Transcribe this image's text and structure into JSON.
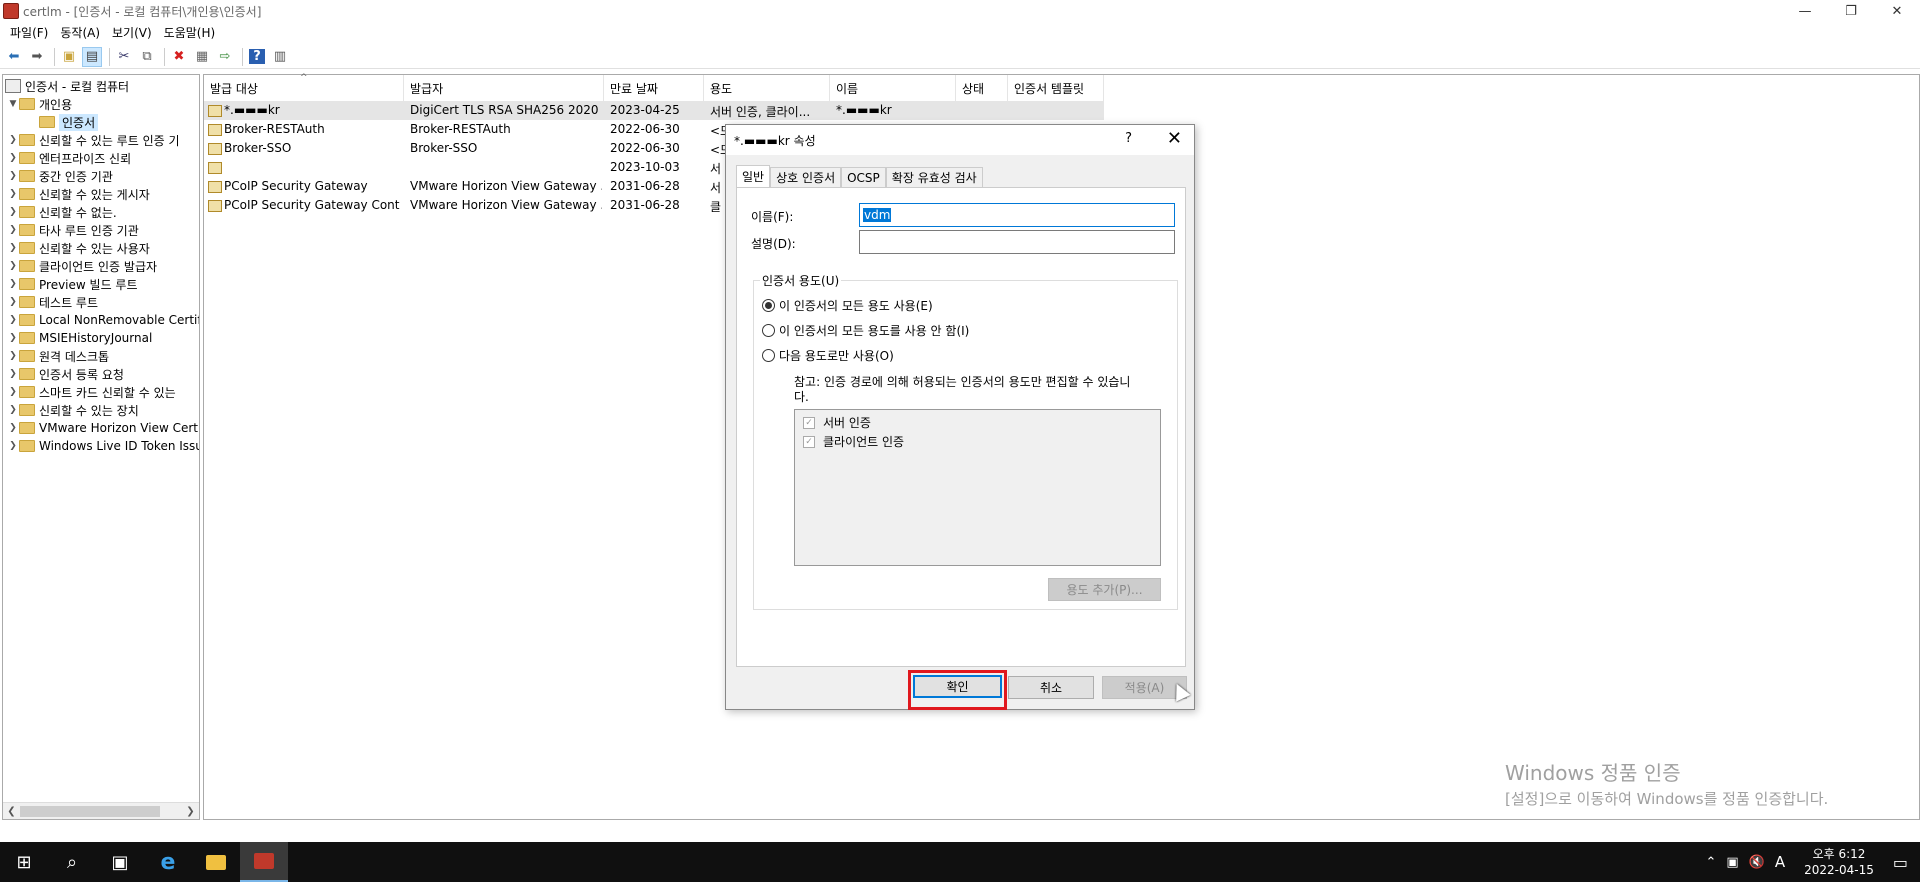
{
  "window": {
    "title": "certlm - [인증서 - 로컬 컴퓨터\\개인용\\인증서]",
    "minimize": "—",
    "restore": "❐",
    "close": "✕"
  },
  "menu": [
    "파일(F)",
    "동작(A)",
    "보기(V)",
    "도움말(H)"
  ],
  "toolbar": {
    "icons": [
      "back-icon",
      "forward-icon",
      "up-folder-icon",
      "show-hide-tree-icon",
      "cut-icon",
      "copy-icon",
      "delete-icon",
      "properties-icon",
      "export-icon",
      "help-icon",
      "console-icon"
    ]
  },
  "tree": {
    "root": "인증서 - 로컬 컴퓨터",
    "personal": "개인용",
    "certs": "인증서",
    "items": [
      "신뢰할 수 있는 루트 인증 기",
      "엔터프라이즈 신뢰",
      "중간 인증 기관",
      "신뢰할 수 있는 게시자",
      "신뢰할 수 없는.",
      "타사 루트 인증 기관",
      "신뢰할 수 있는 사용자",
      "클라이언트 인증 발급자",
      "Preview 빌드 루트",
      "테스트 루트",
      "Local NonRemovable Certific",
      "MSIEHistoryJournal",
      "원격 데스크톱",
      "인증서 등록 요청",
      "스마트 카드 신뢰할 수 있는",
      "신뢰할 수 있는 장치",
      "VMware Horizon View Certif",
      "Windows Live ID Token Issue"
    ]
  },
  "list": {
    "columns": [
      "발급 대상",
      "발급자",
      "만료 날짜",
      "용도",
      "이름",
      "상태",
      "인증서 템플릿"
    ],
    "rows": [
      [
        "*.▬▬▬kr",
        "DigiCert TLS RSA SHA256 2020 ...",
        "2023-04-25",
        "서버 인증, 클라이...",
        "*.▬▬▬kr"
      ],
      [
        "Broker-RESTAuth",
        "Broker-RESTAuth",
        "2022-06-30",
        "<모",
        ""
      ],
      [
        "Broker-SSO",
        "Broker-SSO",
        "2022-06-30",
        "<모",
        ""
      ],
      [
        "",
        "",
        "2023-10-03",
        "서",
        ""
      ],
      [
        "PCoIP Security Gateway",
        "VMware Horizon View Gateway ...",
        "2031-06-28",
        "서",
        ""
      ],
      [
        "PCoIP Security Gateway Contr...",
        "VMware Horizon View Gateway ...",
        "2031-06-28",
        "클",
        ""
      ]
    ]
  },
  "dialog": {
    "title": "*.▬▬▬kr 속성",
    "help": "?",
    "close": "✕",
    "tabs": [
      "일반",
      "상호 인증서",
      "OCSP",
      "확장 유효성 검사"
    ],
    "name_label": "이름(F):",
    "name_value": "vdm",
    "desc_label": "설명(D):",
    "desc_value": "",
    "purpose_group": "인증서 용도(U)",
    "radio_all": "이 인증서의 모든 용도 사용(E)",
    "radio_none": "이 인증서의 모든 용도를 사용 안 함(I)",
    "radio_only": "다음 용도로만 사용(O)",
    "note": "참고: 인증 경로에 의해 허용되는 인증서의 용도만 편집할 수 있습니다.",
    "purposes": [
      "서버 인증",
      "클라이언트 인증"
    ],
    "add_purpose": "용도 추가(P)...",
    "ok": "확인",
    "cancel": "취소",
    "apply": "적용(A)"
  },
  "watermark": {
    "line1": "Windows 정품 인증",
    "line2": "[설정]으로 이동하여 Windows를 정품 인증합니다."
  },
  "taskbar": {
    "time": "오후 6:12",
    "date": "2022-04-15",
    "ime": "A"
  }
}
